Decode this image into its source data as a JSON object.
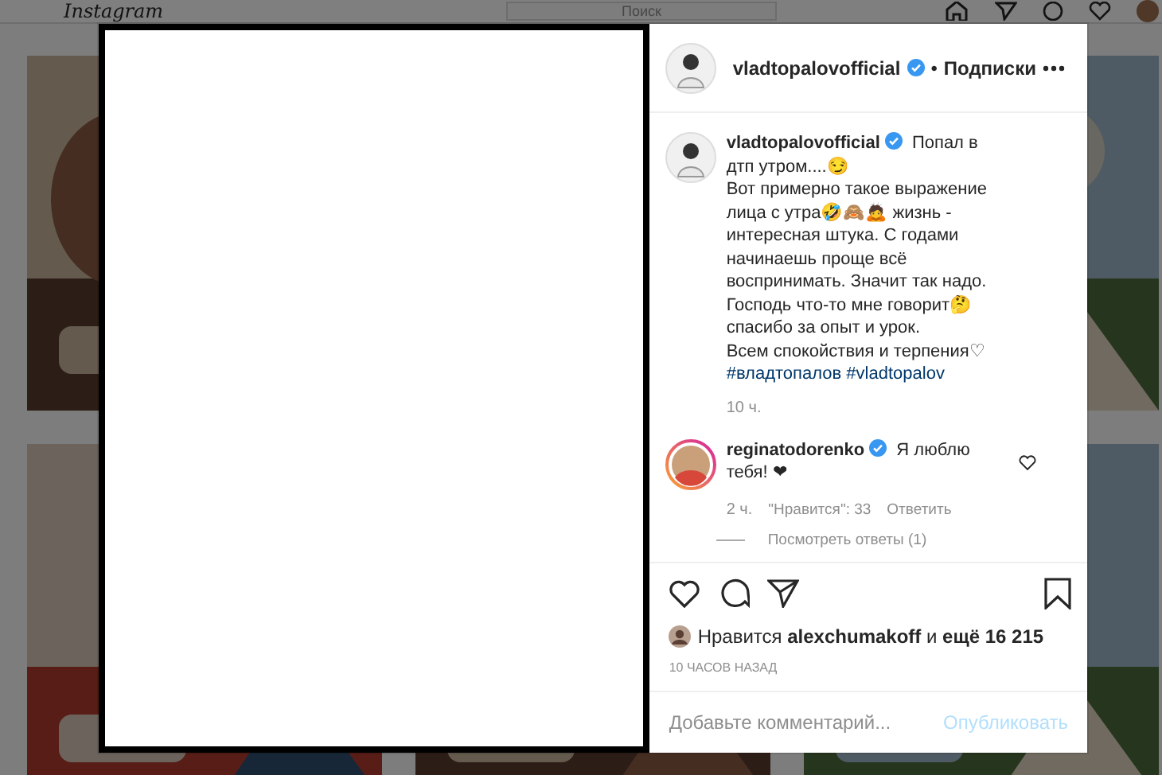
{
  "header": {
    "logo": "Instagram",
    "search": {
      "placeholder": "Поиск"
    }
  },
  "post": {
    "author": "vladtopalovofficial",
    "verified": true,
    "separator": "•",
    "follow_label": "Подписки",
    "caption_author": "vladtopalovofficial",
    "caption_verified": true,
    "caption": "Попал в дтп утром....😏\nВот примерно такое выражение лица с утра🤣🙈🙇 жизнь - интересная штука. С годами начинаешь проще всё воспринимать. Значит так надо.\nГосподь что-то мне говорит🤔\nспасибо за опыт и урок.\nВсем спокойствия и терпения♡",
    "hashtags": [
      "#владтопалов",
      "#vladtopalov"
    ],
    "time": "10 ч."
  },
  "comments": [
    {
      "user": "reginatodorenko",
      "verified": true,
      "text": "Я люблю тебя! ❤",
      "time": "2 ч.",
      "likes": "\"Нравится\": 33",
      "reply": "Ответить",
      "liked": false,
      "view_replies": "Посмотреть ответы (1)"
    }
  ],
  "actions": {
    "liked": false,
    "saved": false
  },
  "likes": "Нравится **alexchumakoff** и **ещё 16 215**",
  "date": "10 ЧАСОВ НАЗАД",
  "comment_field": {
    "placeholder": "Добавьте комментарий...",
    "submit": "Опубликовать",
    "submit_disabled": true
  }
}
